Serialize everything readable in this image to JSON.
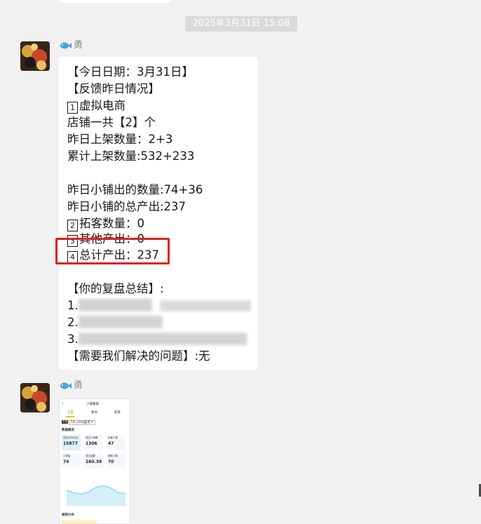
{
  "timestamp": "2025年3月31日 15:08",
  "messages": [
    {
      "sender": "勇",
      "lines": [
        "【今日日期：3月31日】",
        "【反馈昨日情况】",
        "虚拟电商",
        "店铺一共【2】个",
        "昨日上架数量：2+3",
        "累计上架数量:532+233",
        "昨日小铺出的数量:74+36",
        "昨日小铺的总产出:237",
        "拓客数量：0",
        "其他产出：0",
        "总计产出：237",
        "【你的复盘总结】:",
        "1.",
        "2.",
        "3.",
        "【需要我们解决的问题】:无"
      ],
      "box_numbers": [
        "1",
        "2",
        "3",
        "4"
      ]
    },
    {
      "sender": "勇",
      "thumbnail": {
        "title": "小铺数据",
        "tabs": [
          "全量",
          "图书",
          "新客"
        ],
        "period_tabs": [
          "1天",
          "7天",
          "30天",
          "自定义"
        ],
        "section": "数据概览",
        "stats": [
          {
            "label": "成交GMV(元)",
            "value": "15877"
          },
          {
            "label": "成交订单数",
            "value": "1306"
          },
          {
            "label": "访客人数",
            "value": "47"
          },
          {
            "label": "订单量",
            "value": "74"
          },
          {
            "label": "成交金额",
            "value": "160.38"
          },
          {
            "label": "退款人数",
            "value": "70"
          }
        ],
        "chart_series": [
          1500,
          1420,
          1380,
          1450,
          1600,
          1650,
          1580,
          1420,
          1400
        ],
        "footer": "推荐分布"
      }
    }
  ],
  "colors": {
    "background": "#f1f1f1",
    "bubble": "#ffffff",
    "highlight": "#e02020",
    "timestamp_bg": "#dadada"
  }
}
